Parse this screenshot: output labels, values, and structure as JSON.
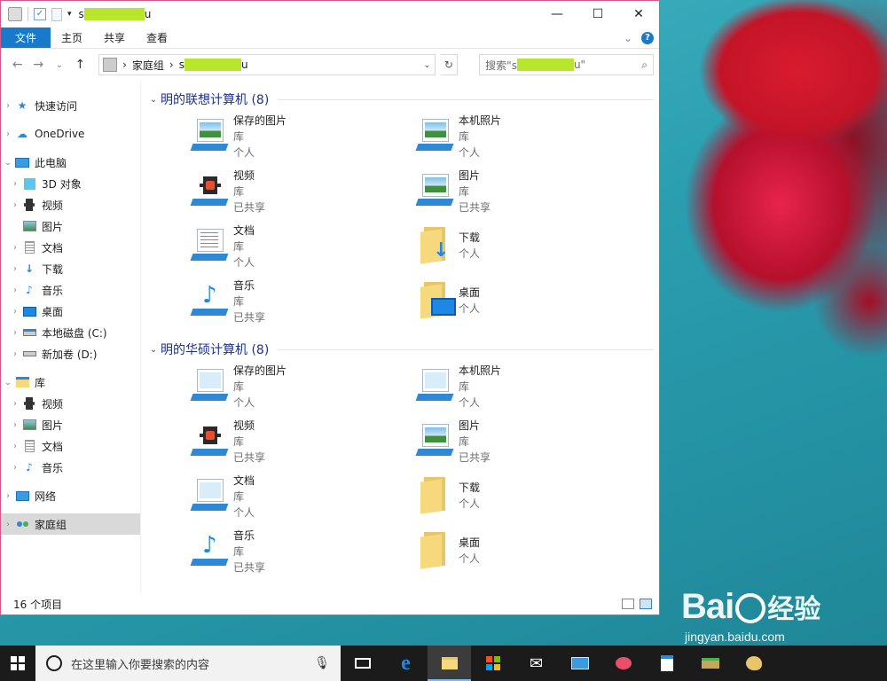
{
  "window": {
    "title_prefix": "s",
    "title_suffix": "u",
    "minimize": "—",
    "maximize": "☐",
    "close": "✕"
  },
  "ribbon": {
    "tabs": [
      "文件",
      "主页",
      "共享",
      "查看"
    ],
    "expand": "⌄",
    "help": "?"
  },
  "nav": {
    "back": "←",
    "forward": "→",
    "recent": "⌄",
    "up": "↑",
    "address_root": "家庭组",
    "address_sep": "›",
    "address_user_prefix": "s",
    "address_user_suffix": "u",
    "address_dropdown": "⌄",
    "refresh": "↻",
    "search_prefix": "搜索\"s",
    "search_suffix": "u\"",
    "search_icon": "⌕"
  },
  "sidebar": {
    "items": [
      {
        "label": "快速访问",
        "icon": "star-icon"
      },
      {
        "label": "OneDrive",
        "icon": "cloud-icon"
      },
      {
        "label": "此电脑",
        "icon": "pc-icon"
      },
      {
        "label": "3D 对象",
        "icon": "cube-icon"
      },
      {
        "label": "视频",
        "icon": "video-icon"
      },
      {
        "label": "图片",
        "icon": "picture-icon"
      },
      {
        "label": "文档",
        "icon": "document-icon"
      },
      {
        "label": "下载",
        "icon": "download-icon"
      },
      {
        "label": "音乐",
        "icon": "music-icon"
      },
      {
        "label": "桌面",
        "icon": "desktop-icon"
      },
      {
        "label": "本地磁盘 (C:)",
        "icon": "drive-c-icon"
      },
      {
        "label": "新加卷 (D:)",
        "icon": "drive-d-icon"
      },
      {
        "label": "库",
        "icon": "library-icon"
      },
      {
        "label": "视频",
        "icon": "video-icon"
      },
      {
        "label": "图片",
        "icon": "picture-icon"
      },
      {
        "label": "文档",
        "icon": "document-icon"
      },
      {
        "label": "音乐",
        "icon": "music-icon"
      },
      {
        "label": "网络",
        "icon": "network-icon"
      },
      {
        "label": "家庭组",
        "icon": "homegroup-icon"
      }
    ]
  },
  "groups": [
    {
      "title": "明的联想计算机 (8)",
      "items": [
        {
          "name": "保存的图片",
          "type": "库",
          "status": "个人",
          "icon": "saved-pictures-icon"
        },
        {
          "name": "本机照片",
          "type": "库",
          "status": "个人",
          "icon": "camera-roll-icon"
        },
        {
          "name": "视频",
          "type": "库",
          "status": "已共享",
          "icon": "videos-library-icon"
        },
        {
          "name": "图片",
          "type": "库",
          "status": "已共享",
          "icon": "pictures-library-icon"
        },
        {
          "name": "文档",
          "type": "库",
          "status": "个人",
          "icon": "documents-library-icon"
        },
        {
          "name": "下载",
          "type": "",
          "status": "个人",
          "icon": "downloads-folder-icon"
        },
        {
          "name": "音乐",
          "type": "库",
          "status": "已共享",
          "icon": "music-library-icon"
        },
        {
          "name": "桌面",
          "type": "",
          "status": "个人",
          "icon": "desktop-folder-icon"
        }
      ]
    },
    {
      "title": "明的华硕计算机 (8)",
      "items": [
        {
          "name": "保存的图片",
          "type": "库",
          "status": "个人",
          "icon": "saved-pictures-icon"
        },
        {
          "name": "本机照片",
          "type": "库",
          "status": "个人",
          "icon": "camera-roll-icon"
        },
        {
          "name": "视频",
          "type": "库",
          "status": "已共享",
          "icon": "videos-library-icon"
        },
        {
          "name": "图片",
          "type": "库",
          "status": "已共享",
          "icon": "pictures-library-icon"
        },
        {
          "name": "文档",
          "type": "库",
          "status": "个人",
          "icon": "documents-library-icon"
        },
        {
          "name": "下载",
          "type": "",
          "status": "个人",
          "icon": "downloads-folder-icon"
        },
        {
          "name": "音乐",
          "type": "库",
          "status": "已共享",
          "icon": "music-library-icon"
        },
        {
          "name": "桌面",
          "type": "",
          "status": "个人",
          "icon": "desktop-folder-icon"
        }
      ]
    }
  ],
  "status": {
    "count": "16 个项目"
  },
  "taskbar": {
    "search_placeholder": "在这里输入你要搜索的内容",
    "mic": "🎤",
    "apps": [
      "task-view-icon",
      "edge-icon",
      "file-explorer-icon",
      "store-icon",
      "mail-icon",
      "control-panel-icon",
      "paint-icon",
      "wordpad-icon",
      "book-icon",
      "palette-icon"
    ]
  },
  "watermark": {
    "brand_left": "Bai",
    "brand_right": "经验",
    "url": "jingyan.baidu.com"
  },
  "colors": {
    "accent": "#1979ca",
    "group_title": "#1e3287",
    "redaction": "#b8e62d",
    "window_border": "#d6588a"
  }
}
